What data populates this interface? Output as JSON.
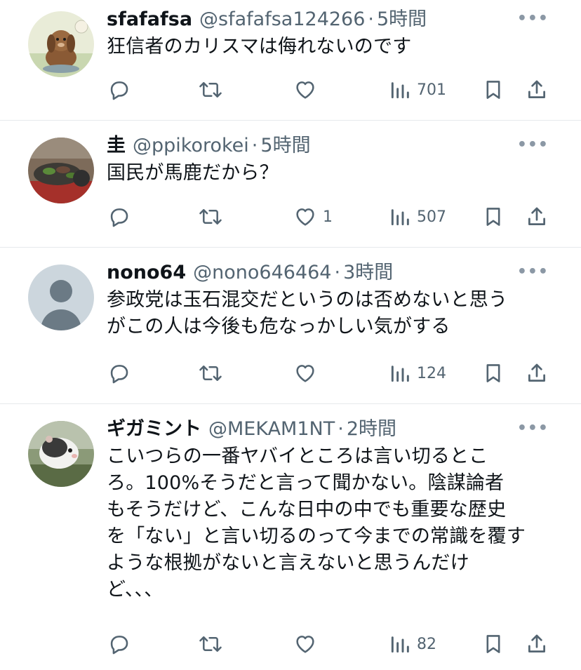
{
  "tweets": [
    {
      "name": "sfafafsa",
      "handle": "@sfafafsa124266",
      "separator": "·",
      "time": "5時間",
      "lines": [
        "狂信者のカリスマは侮れないのです"
      ],
      "replies": "",
      "retweets": "",
      "likes": "",
      "views": "701",
      "avatar": "dog-avatar"
    },
    {
      "name": "圭",
      "handle": "@ppikorokei",
      "separator": "·",
      "time": "5時間",
      "lines": [
        "国民が馬鹿だから？"
      ],
      "replies": "",
      "retweets": "",
      "likes": "1",
      "views": "507",
      "avatar": "food-avatar"
    },
    {
      "name": "nono64",
      "handle": "@nono646464",
      "separator": "·",
      "time": "3時間",
      "lines": [
        "参政党は玉石混交だというのは否めないと思う",
        "がこの人は今後も危なっかしい気がする"
      ],
      "replies": "",
      "retweets": "",
      "likes": "",
      "views": "124",
      "avatar": "default-avatar"
    },
    {
      "name": "ギガミント",
      "handle": "@MEKAM1NT",
      "separator": "·",
      "time": "2時間",
      "lines": [
        "こいつらの一番ヤバイところは言い切るとこ",
        "ろ。100%そうだと言って聞かない。陰謀論者",
        "もそうだけど、こんな日中の中でも重要な歴史",
        "を「ない」と言い切るのって今までの常識を覆す",
        "ような根拠がないと言えないと思うんだけ",
        "ど、、、"
      ],
      "replies": "",
      "retweets": "",
      "likes": "",
      "views": "82",
      "avatar": "hamster-avatar"
    }
  ],
  "more_label": "•••",
  "colors": {
    "text": "#0f1419",
    "secondary": "#536471",
    "divider": "#e6e9ec"
  }
}
